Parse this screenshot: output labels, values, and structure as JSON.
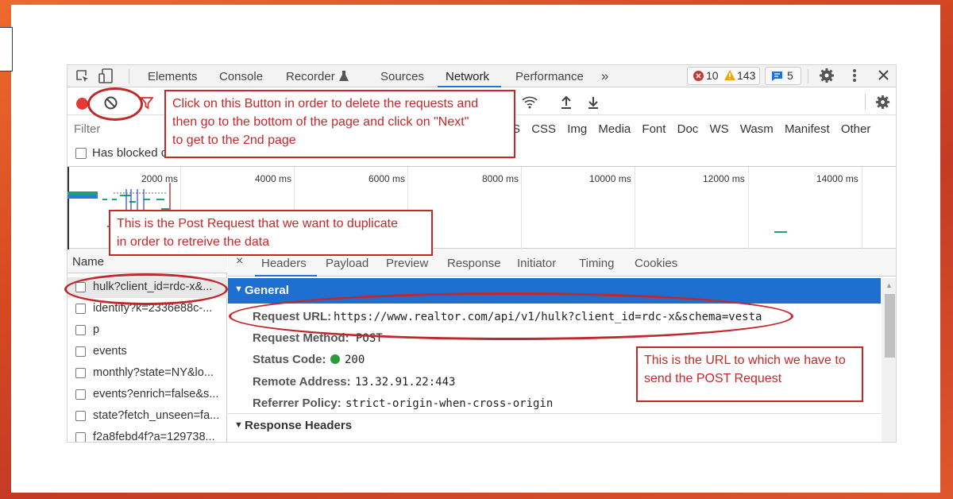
{
  "colors": {
    "accent": "#1a73e8",
    "general_bar": "#1f6fd1",
    "annotation": "#c62828",
    "record": "#e53935",
    "status_ok": "#2e9b3a"
  },
  "tabs": [
    {
      "label": "Elements",
      "icon": "inspect-icon"
    },
    {
      "label": "Console"
    },
    {
      "label": "Recorder"
    },
    {
      "label": "Sources"
    },
    {
      "label": "Network",
      "active": true
    },
    {
      "label": "Performance"
    }
  ],
  "badges": {
    "errors": "10",
    "warnings": "143",
    "messages": "5"
  },
  "filter": {
    "placeholder": "Filter"
  },
  "type_filters": [
    "S",
    "CSS",
    "Img",
    "Media",
    "Font",
    "Doc",
    "WS",
    "Wasm",
    "Manifest",
    "Other"
  ],
  "blocked_label": "Has blocked c",
  "timeline": {
    "labels": [
      "2000 ms",
      "4000 ms",
      "6000 ms",
      "8000 ms",
      "10000 ms",
      "12000 ms",
      "14000 ms"
    ]
  },
  "name_header": "Name",
  "requests": [
    "hulk?client_id=rdc-x&...",
    "identify?k=2336e88c-...",
    "p",
    "events",
    "monthly?state=NY&lo...",
    "events?enrich=false&s...",
    "state?fetch_unseen=fa...",
    "f2a8febd4f?a=129738..."
  ],
  "detail_tabs": [
    "Headers",
    "Payload",
    "Preview",
    "Response",
    "Initiator",
    "Timing",
    "Cookies"
  ],
  "general": {
    "title": "General",
    "request_url_label": "Request URL:",
    "request_url": "https://www.realtor.com/api/v1/hulk?client_id=rdc-x&schema=vesta",
    "request_method_label": "Request Method:",
    "request_method": "POST",
    "status_label": "Status Code:",
    "status": "200",
    "remote_label": "Remote Address:",
    "remote": "13.32.91.22:443",
    "referrer_label": "Referrer Policy:",
    "referrer": "strict-origin-when-cross-origin"
  },
  "response_headers": "Response Headers",
  "annotations": {
    "clear_button_note": [
      "Click on this Button in order to delete the requests and",
      "then go to the bottom of the page and click on \"Next\"",
      "to get to the 2nd page"
    ],
    "post_request_note": [
      "This is the Post Request that we want to duplicate",
      "in order to retreive the data"
    ],
    "url_note": [
      "This is the URL to which we have to",
      "send the POST Request"
    ]
  }
}
